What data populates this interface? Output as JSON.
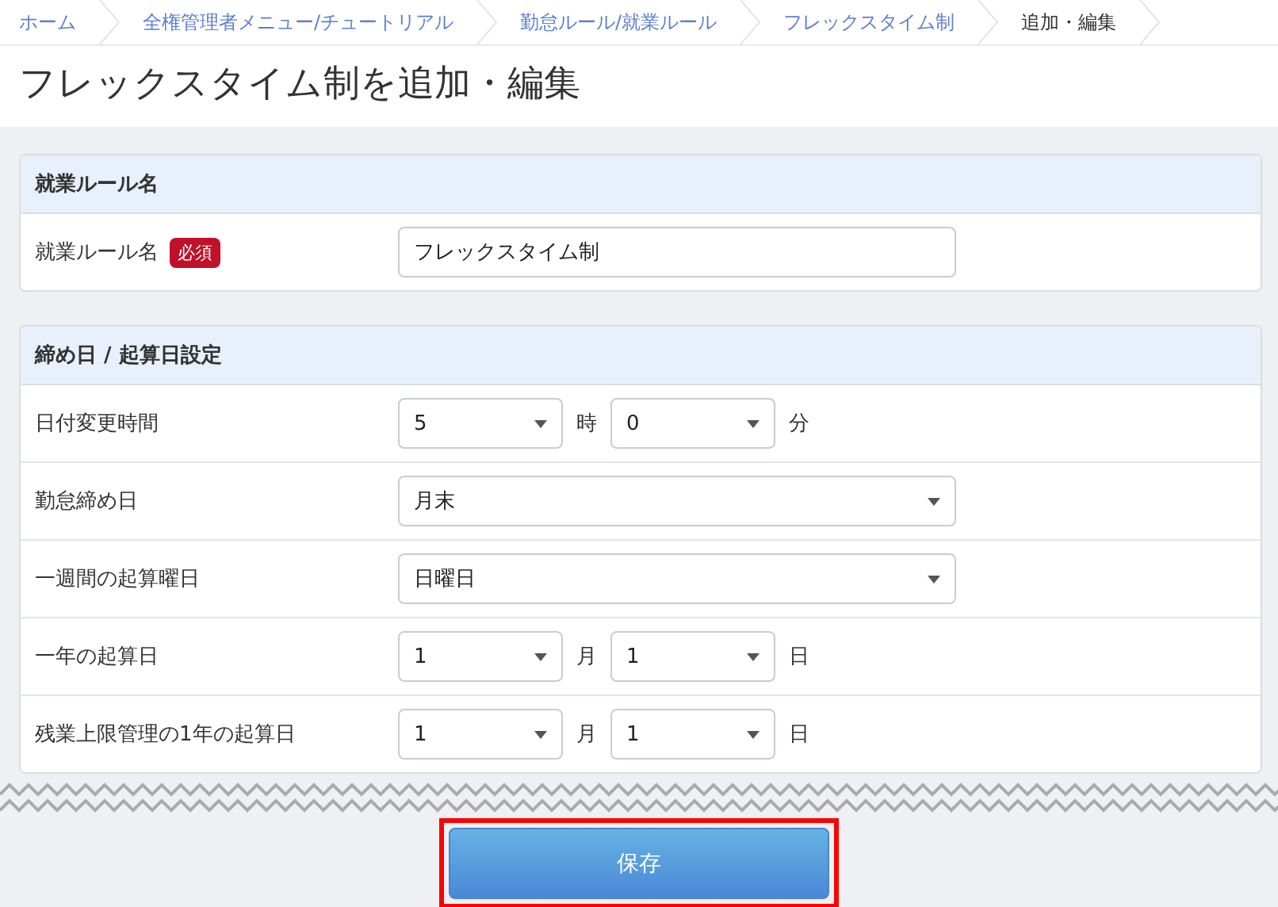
{
  "breadcrumb": [
    {
      "label": "ホーム",
      "current": false
    },
    {
      "label": "全権管理者メニュー/チュートリアル",
      "current": false
    },
    {
      "label": "勤怠ルール/就業ルール",
      "current": false
    },
    {
      "label": "フレックスタイム制",
      "current": false
    },
    {
      "label": "追加・編集",
      "current": true
    }
  ],
  "page_title": "フレックスタイム制を追加・編集",
  "sections": [
    {
      "title": "就業ルール名",
      "rows": [
        {
          "kind": "text",
          "label": "就業ルール名",
          "badge": "必須",
          "value": "フレックスタイム制"
        }
      ]
    },
    {
      "title": "締め日 / 起算日設定",
      "rows": [
        {
          "kind": "pair",
          "label": "日付変更時間",
          "first": "5",
          "first_unit": "時",
          "second": "0",
          "second_unit": "分"
        },
        {
          "kind": "select",
          "label": "勤怠締め日",
          "value": "月末"
        },
        {
          "kind": "select",
          "label": "一週間の起算曜日",
          "value": "日曜日"
        },
        {
          "kind": "pair",
          "label": "一年の起算日",
          "first": "1",
          "first_unit": "月",
          "second": "1",
          "second_unit": "日"
        },
        {
          "kind": "pair",
          "label": "残業上限管理の1年の起算日",
          "first": "1",
          "first_unit": "月",
          "second": "1",
          "second_unit": "日"
        }
      ]
    }
  ],
  "save_button": {
    "label": "保存",
    "highlighted": true
  }
}
